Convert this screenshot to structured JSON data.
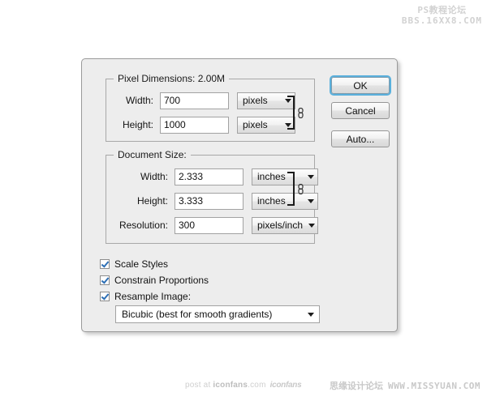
{
  "dialog": {
    "pixel_dimensions": {
      "legend": "Pixel Dimensions:  2.00M",
      "width": {
        "label": "Width:",
        "value": "700",
        "unit": "pixels"
      },
      "height": {
        "label": "Height:",
        "value": "1000",
        "unit": "pixels"
      },
      "link_icon": "chain-link-icon"
    },
    "document_size": {
      "legend": "Document Size:",
      "width": {
        "label": "Width:",
        "value": "2.333",
        "unit": "inches"
      },
      "height": {
        "label": "Height:",
        "value": "3.333",
        "unit": "inches"
      },
      "resolution": {
        "label": "Resolution:",
        "value": "300",
        "unit": "pixels/inch"
      },
      "link_icon": "chain-link-icon"
    },
    "options": {
      "scale_styles": {
        "label": "Scale Styles",
        "checked": true
      },
      "constrain_proportions": {
        "label": "Constrain Proportions",
        "checked": true
      },
      "resample_image": {
        "label": "Resample Image:",
        "checked": true
      },
      "resample_method": "Bicubic (best for smooth gradients)"
    },
    "buttons": {
      "ok": "OK",
      "cancel": "Cancel",
      "auto": "Auto..."
    },
    "accent_color": "#5ab0dc",
    "check_color": "#2d6fb5",
    "background_color": "#ededed"
  },
  "watermarks": {
    "top_right_line1": "PS教程论坛",
    "top_right_line2": "BBS.16XX8.COM",
    "bottom_center_prefix": "post at ",
    "bottom_center_brand": "iconfans",
    "bottom_center_suffix": ".com",
    "bottom_center_logo": "iconfans",
    "bottom_right_cn": "思缘设计论坛",
    "bottom_right_url": "WWW.MISSYUAN.COM"
  }
}
